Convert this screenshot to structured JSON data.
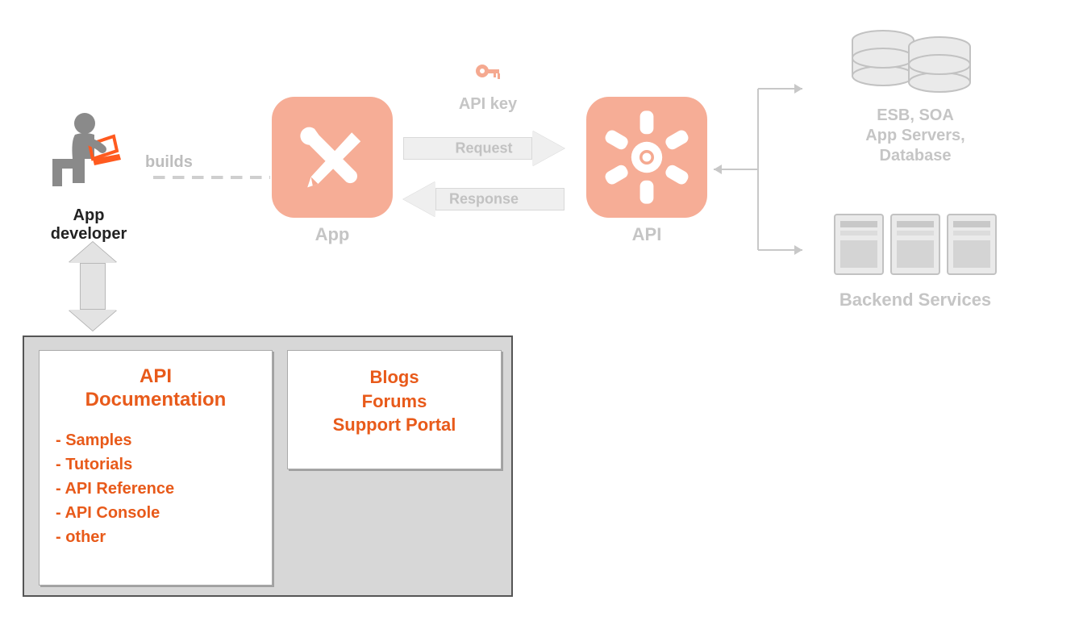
{
  "developer": {
    "label": "App developer"
  },
  "builds": {
    "label": "builds"
  },
  "app": {
    "label": "App"
  },
  "api_key": {
    "label": "API key"
  },
  "request": {
    "label": "Request"
  },
  "response": {
    "label": "Response"
  },
  "api": {
    "label": "API"
  },
  "backend_top": {
    "line1": "ESB, SOA",
    "line2": "App Servers,",
    "line3": "Database"
  },
  "backend_bottom": {
    "title": "Backend Services"
  },
  "doc_card": {
    "title_l1": "API",
    "title_l2": "Documentation",
    "items": [
      "- Samples",
      "- Tutorials",
      "- API Reference",
      "- API Console",
      "- other"
    ]
  },
  "support_card": {
    "line1": "Blogs",
    "line2": "Forums",
    "line3": "Support Portal"
  },
  "colors": {
    "accent": "#e85a1a",
    "faded": "#c5c5c5",
    "app_tile": "#f5a990"
  }
}
